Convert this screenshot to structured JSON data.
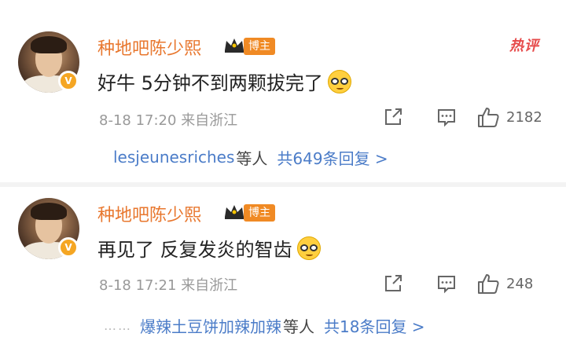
{
  "comments": [
    {
      "username": "种地吧陈少熙",
      "badge": "博主",
      "hot_label": "热评",
      "text": "好牛 5分钟不到两颗拔完了",
      "emoji": "nerd-face-emoji",
      "time": "8-18 17:20",
      "location": "来自浙江",
      "likes": "2182",
      "reply_dots": "",
      "reply_user": "lesjeunesriches",
      "reply_etc": "等人",
      "reply_total": "共649条回复 >"
    },
    {
      "username": "种地吧陈少熙",
      "badge": "博主",
      "text": "再见了 反复发炎的智齿",
      "emoji": "nerd-face-emoji",
      "time": "8-18 17:21",
      "location": "来自浙江",
      "likes": "248",
      "reply_dots": "……",
      "reply_user": "爆辣土豆饼加辣加辣",
      "reply_etc": "等人",
      "reply_total": "共18条回复 >"
    }
  ],
  "colors": {
    "username": "#e8772e",
    "badge_bg": "#f08a24",
    "hot": "#e64b4b",
    "link": "#4b7cc8",
    "meta": "#999999"
  }
}
